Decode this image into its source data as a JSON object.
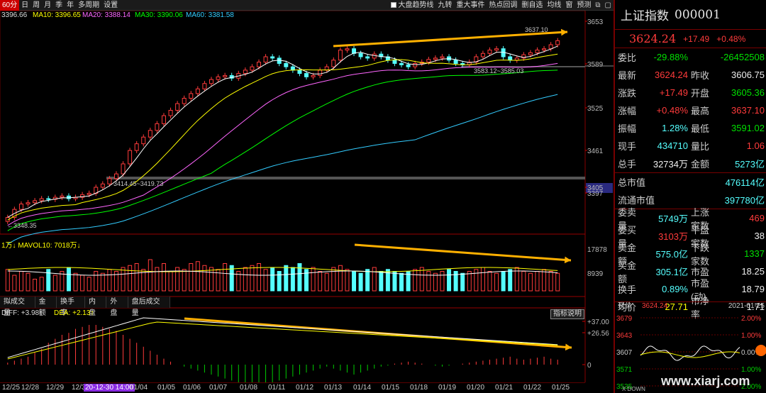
{
  "toolbar": {
    "periods": [
      "60分",
      "日",
      "周",
      "月",
      "季",
      "年",
      "多周期",
      "设置"
    ],
    "tools": [
      "大盘趋势线",
      "九转",
      "重大事件",
      "热点回调",
      "删自选",
      "均线",
      "窗",
      "预测"
    ],
    "icons": [
      "copy-icon",
      "window-icon"
    ]
  },
  "ma_legend": {
    "close": "3396.66",
    "ma10": "MA10: 3396.65",
    "ma20": "MA20: 3388.14",
    "ma30": "MA30: 3390.06",
    "ma60": "MA60: 3381.58",
    "colors": {
      "ma10": "#ffff00",
      "ma20": "#ff66ff",
      "ma30": "#00ff00",
      "ma60": "#33ccff"
    }
  },
  "price_axis": {
    "labels": [
      "3653",
      "3589",
      "3525",
      "3461",
      "3405",
      "3397"
    ],
    "box_label": "3405"
  },
  "price_annotations": {
    "low": "3348.35",
    "top_arrow": "3637.10",
    "range1": "3414.45~3419.73",
    "range2": "3583.12~3585.03"
  },
  "vol_panel": {
    "header": "1万↓ MAVOL10: 7018万↓",
    "axis": [
      "17878",
      "8939"
    ]
  },
  "mid_tabs": [
    "拟成交量",
    "金额",
    "换手率",
    "内盘",
    "外盘",
    "盘后成交量"
  ],
  "macd_panel": {
    "header_diff": "DIFF: +3.98↑",
    "header_dea": "DEA: +2.13↑",
    "help_button": "指标说明",
    "axis": [
      "+37.00",
      "+26.56",
      "0"
    ]
  },
  "dates": [
    "12/25",
    "12/28",
    "12/29",
    "12/3",
    "20-12-30 14:00",
    "01/04",
    "01/05",
    "01/06",
    "01/07",
    "01/08",
    "01/11",
    "01/12",
    "01/13",
    "01/14",
    "01/15",
    "01/18",
    "01/19",
    "01/20",
    "01/21",
    "01/22",
    "01/25"
  ],
  "quote": {
    "name": "上证指数",
    "code": "000001",
    "price": "3624.24",
    "chg": "+17.49",
    "pct": "+0.48%",
    "rows": [
      {
        "l": "委比",
        "v": "-29.88%",
        "vc": "grn",
        "l2": "",
        "v2": "-26452508",
        "v2c": "grn"
      },
      {
        "l": "最新",
        "v": "3624.24",
        "vc": "red",
        "l2": "昨收",
        "v2": "3606.75",
        "v2c": "wht"
      },
      {
        "l": "涨跌",
        "v": "+17.49",
        "vc": "red",
        "l2": "开盘",
        "v2": "3605.36",
        "v2c": "grn"
      },
      {
        "l": "涨幅",
        "v": "+0.48%",
        "vc": "red",
        "l2": "最高",
        "v2": "3637.10",
        "v2c": "red"
      },
      {
        "l": "振幅",
        "v": "1.28%",
        "vc": "cyn",
        "l2": "最低",
        "v2": "3591.02",
        "v2c": "grn"
      },
      {
        "l": "现手",
        "v": "434710",
        "vc": "cyn",
        "l2": "量比",
        "v2": "1.06",
        "v2c": "red"
      },
      {
        "l": "总手",
        "v": "32734万",
        "vc": "wht",
        "l2": "金额",
        "v2": "5273亿",
        "v2c": "cyn"
      }
    ],
    "mkt": [
      {
        "l": "总市值",
        "v": "476114亿"
      },
      {
        "l": "流通市值",
        "v": "397780亿"
      }
    ],
    "rows2": [
      {
        "l": "委卖量",
        "v": "5749万",
        "vc": "cyn",
        "l2": "上涨家数",
        "v2": "469",
        "v2c": "red"
      },
      {
        "l": "委买量",
        "v": "3103万",
        "vc": "red",
        "l2": "平盘家数",
        "v2": "38",
        "v2c": "wht"
      },
      {
        "l": "卖金额",
        "v": "575.0亿",
        "vc": "cyn",
        "l2": "下跌家数",
        "v2": "1337",
        "v2c": "grn"
      },
      {
        "l": "买金额",
        "v": "305.1亿",
        "vc": "cyn",
        "l2": "市盈",
        "v2": "18.25",
        "v2c": "wht"
      },
      {
        "l": "换手",
        "v": "0.89%",
        "vc": "cyn",
        "l2": "市盈(动)",
        "v2": "18.79",
        "v2c": "wht"
      },
      {
        "l": "均价",
        "v": "27.71",
        "vc": "yel",
        "l2": "市净率",
        "v2": "1.71",
        "v2c": "wht"
      }
    ],
    "mini_header": {
      "l": "现价",
      "v": "3624.24",
      "d": "2021-01-25"
    },
    "mini_axis_left": [
      "3679",
      "3643",
      "3607",
      "3571",
      "3535"
    ],
    "mini_axis_right": [
      "2.00%",
      "1.00%",
      "0.00%",
      "1.00%",
      "2.00%"
    ]
  },
  "watermark": "www.xiarj.com",
  "watermark_sub": "X DOWN"
}
